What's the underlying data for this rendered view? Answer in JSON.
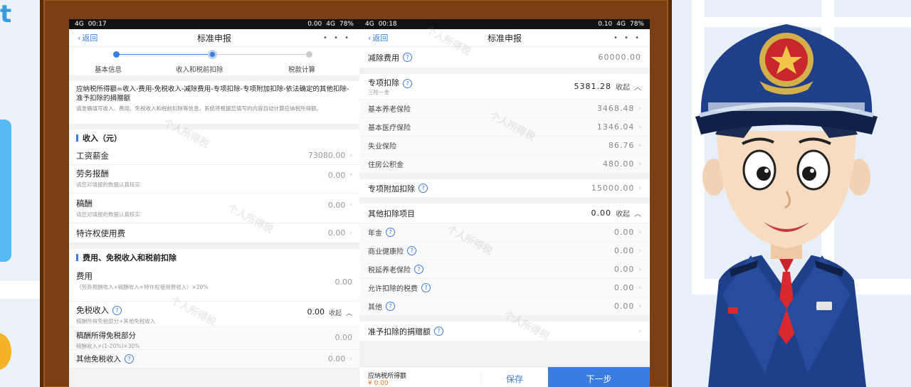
{
  "left_phone": {
    "status": {
      "signal": "4G",
      "time": "00:17",
      "net": "0.00",
      "lte": "4G",
      "battery": "78%"
    },
    "nav": {
      "back": "返回",
      "title": "标准申报",
      "more": "• • •"
    },
    "steps": [
      "基本信息",
      "收入和税前扣除",
      "税款计算"
    ],
    "formula": "应纳税所得额=收入-费用-免税收入-减除费用-专项扣除-专项附加扣除-依法确定的其他扣除-准予扣除的捐赠额",
    "formula_hint": "请准确填写收入、费用、免税收入和税前扣除等信息，系统将根据您填写的内容自动计算应纳税所得额。",
    "income_header": "收入（元）",
    "income_rows": [
      {
        "label": "工资薪金",
        "sub": "",
        "value": "73080.00"
      },
      {
        "label": "劳务报酬",
        "sub": "请您对填报的数据认真核实",
        "value": "0.00"
      },
      {
        "label": "稿酬",
        "sub": "请您对填报的数据认真核实",
        "value": "0.00"
      },
      {
        "label": "特许权使用费",
        "sub": "",
        "value": "0.00"
      }
    ],
    "expense_header": "费用、免税收入和税前扣除",
    "expense_rows": [
      {
        "label": "费用",
        "sub": "（劳务报酬收入+稿酬收入+特许权使用费收入）×20%",
        "value": "0.00"
      },
      {
        "label": "免税收入",
        "sub": "稿酬所得免税部分+其他免税收入",
        "value": "0.00",
        "tag": "收起"
      },
      {
        "label": "稿酬所得免税部分",
        "sub": "稿酬收入×(1-20%)×30%",
        "value": "0.00"
      },
      {
        "label": "其他免税收入",
        "sub": "",
        "value": "0.00"
      }
    ]
  },
  "right_phone": {
    "status": {
      "signal": "4G",
      "time": "00:18",
      "net": "0.10",
      "lte": "4G",
      "battery": "78%"
    },
    "nav": {
      "back": "返回",
      "title": "标准申报",
      "more": "• • •"
    },
    "deduction": {
      "label": "减除费用",
      "value": "60000.00"
    },
    "special": {
      "label": "专项扣除",
      "sub": "三险一金",
      "value": "5381.28",
      "tag": "收起"
    },
    "special_items": [
      {
        "label": "基本养老保险",
        "value": "3468.48"
      },
      {
        "label": "基本医疗保险",
        "value": "1346.04"
      },
      {
        "label": "失业保险",
        "value": "86.76"
      },
      {
        "label": "住房公积金",
        "value": "480.00"
      }
    ],
    "special_additional": {
      "label": "专项附加扣除",
      "value": "15000.00"
    },
    "other": {
      "label": "其他扣除项目",
      "value": "0.00",
      "tag": "收起"
    },
    "other_items": [
      {
        "label": "年金",
        "value": "0.00"
      },
      {
        "label": "商业健康险",
        "value": "0.00"
      },
      {
        "label": "税延养老保险",
        "value": "0.00"
      },
      {
        "label": "允许扣除的税费",
        "value": "0.00"
      },
      {
        "label": "其他",
        "value": "0.00"
      }
    ],
    "donation": {
      "label": "准予扣除的捐赠额"
    },
    "bottom": {
      "taxable_label": "应纳税所得额",
      "taxable_value": "¥ 0.00",
      "save": "保存",
      "next": "下一步"
    }
  },
  "watermark": "个人所得税",
  "decor": {
    "left_letter": "t"
  },
  "colors": {
    "accent": "#3a7de0",
    "frame": "#7a3f12",
    "amount": "#e4731d"
  }
}
